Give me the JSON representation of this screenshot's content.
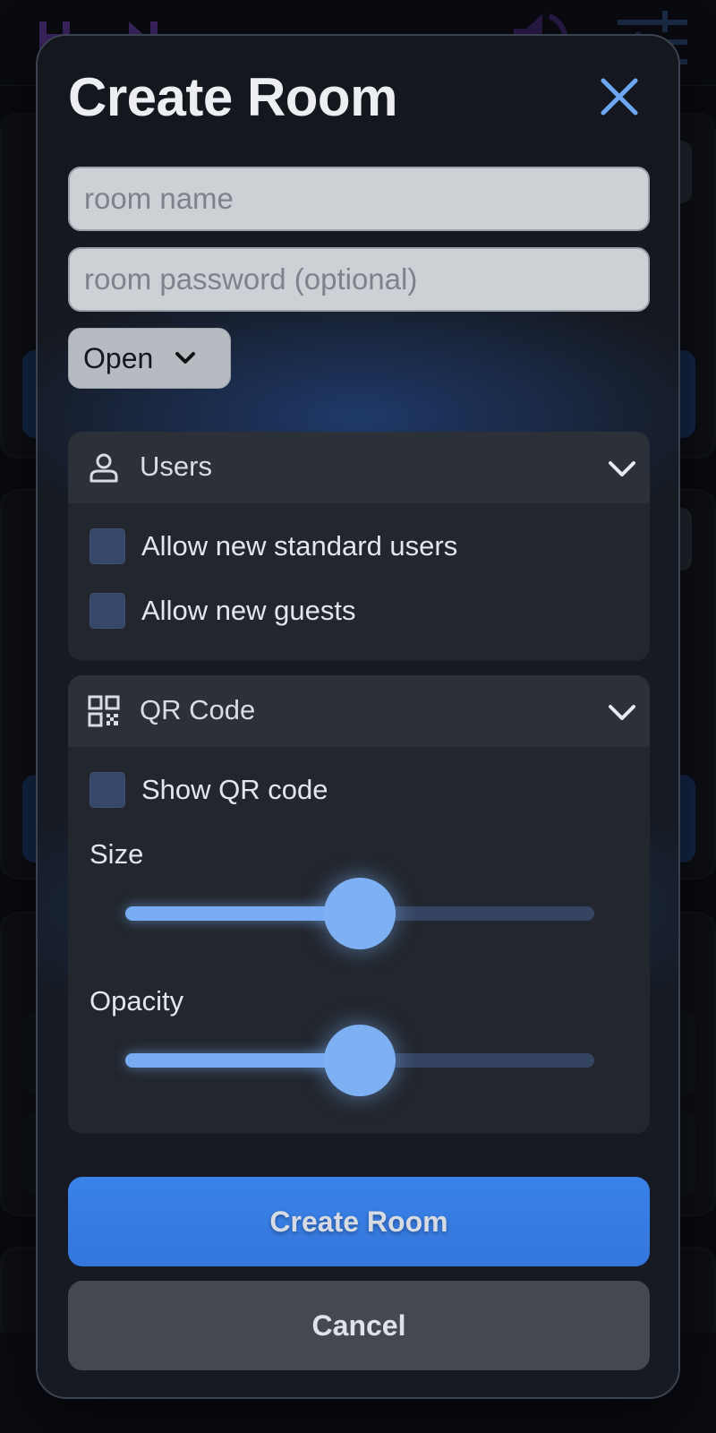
{
  "modal": {
    "title": "Create Room",
    "close_icon": "close-icon",
    "room_name": {
      "placeholder": "room name",
      "value": ""
    },
    "room_password": {
      "placeholder": "room password (optional)",
      "value": ""
    },
    "access_select": {
      "selected": "Open"
    },
    "users_panel": {
      "title": "Users",
      "icon": "person-icon",
      "options": [
        {
          "label": "Allow new standard users",
          "checked": false
        },
        {
          "label": "Allow new guests",
          "checked": false
        }
      ]
    },
    "qr_panel": {
      "title": "QR Code",
      "icon": "qr-code-icon",
      "show_label": "Show QR code",
      "show_checked": false,
      "size_label": "Size",
      "size_value": 0.5,
      "opacity_label": "Opacity",
      "opacity_value": 0.5
    },
    "create_button": "Create Room",
    "cancel_button": "Cancel"
  },
  "colors": {
    "accent": "#3a82e8",
    "slider": "#7eb1f4",
    "checkbox": "#35476a"
  }
}
